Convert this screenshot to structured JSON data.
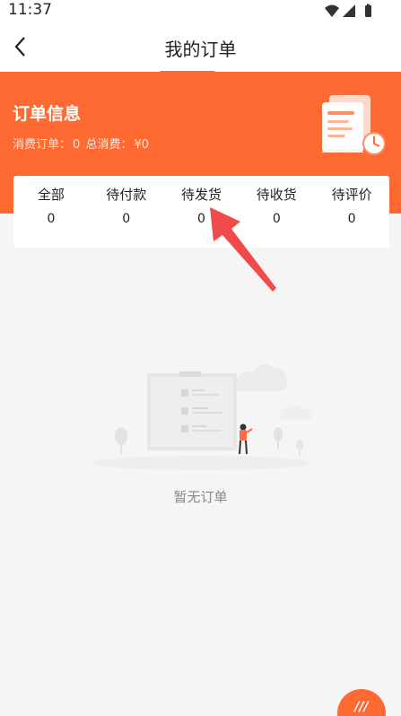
{
  "status_bar": {
    "time": "11:37"
  },
  "app_bar": {
    "title": "我的订单"
  },
  "banner": {
    "title": "订单信息",
    "consume_orders_label": "消费订单：",
    "consume_orders_value": "0",
    "total_spent_label": "总消费：",
    "total_spent_value": "¥0"
  },
  "tabs": [
    {
      "label": "全部",
      "count": "0"
    },
    {
      "label": "待付款",
      "count": "0"
    },
    {
      "label": "待发货",
      "count": "0"
    },
    {
      "label": "待收货",
      "count": "0"
    },
    {
      "label": "待评价",
      "count": "0"
    }
  ],
  "selected_tab": "待发货",
  "empty_state": {
    "message": "暂无订单"
  },
  "floating_button": {
    "label": "///"
  },
  "colors": {
    "accent": "#ff6a33",
    "arrow": "#f04a4a",
    "background": "#f5f5f5"
  }
}
